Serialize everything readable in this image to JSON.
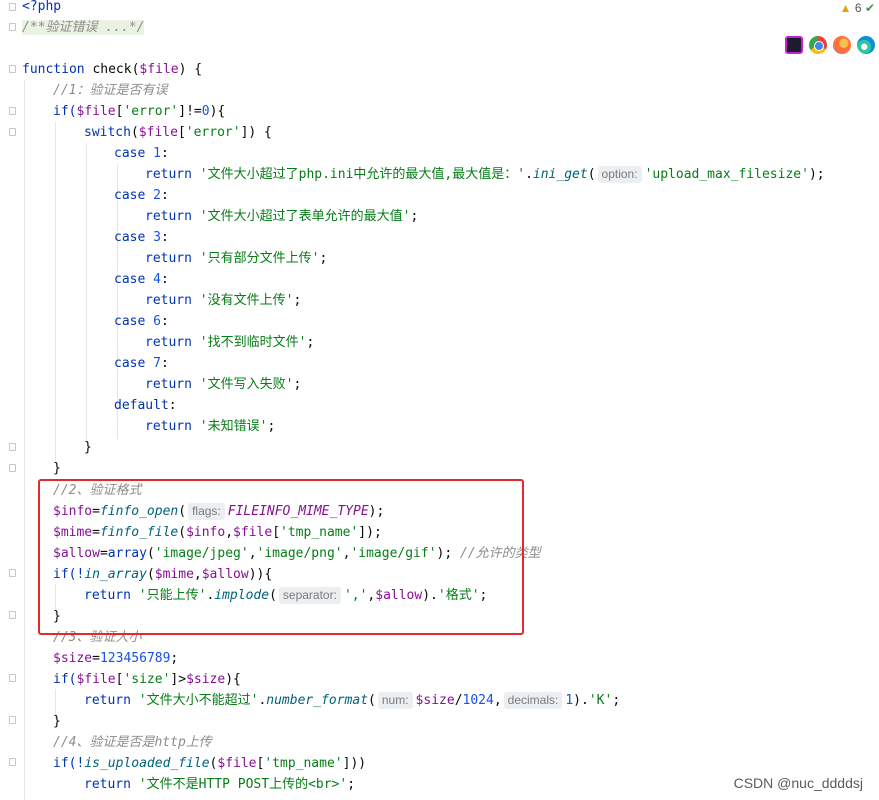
{
  "warnings": {
    "count": "6"
  },
  "browsers": [
    {
      "name": "phpstorm-icon",
      "color": "#1c1c2e"
    },
    {
      "name": "chrome-icon",
      "color": "#34a853"
    },
    {
      "name": "firefox-icon",
      "color": "#ff7139"
    },
    {
      "name": "edge-icon",
      "color": "#0c8fd6"
    }
  ],
  "code": {
    "l1": "<?php",
    "l2": "/**验证错误 ...*/",
    "l4a": "function",
    "l4b": " check(",
    "l4c": "$file",
    "l4d": ") {",
    "l5": "//1：验证是否有误",
    "l6a": "if(",
    "l6b": "$file",
    "l6c": "[",
    "l6d": "'error'",
    "l6e": "]!=",
    "l6f": "0",
    "l6g": "){",
    "l7a": "switch",
    "l7b": "(",
    "l7c": "$file",
    "l7d": "[",
    "l7e": "'error'",
    "l7f": "]) {",
    "c1a": "case ",
    "c1b": "1",
    "c1c": ":",
    "r1a": "return ",
    "r1b": "'文件大小超过了php.ini中允许的最大值,最大值是：'",
    "r1c": ".",
    "r1d": "ini_get",
    "r1e": "(",
    "r1hint": "option:",
    "r1f": "'upload_max_filesize'",
    "r1g": ");",
    "c2a": "case ",
    "c2b": "2",
    "c2c": ":",
    "r2a": "return ",
    "r2b": "'文件大小超过了表单允许的最大值'",
    "r2c": ";",
    "c3a": "case ",
    "c3b": "3",
    "c3c": ":",
    "r3a": "return ",
    "r3b": "'只有部分文件上传'",
    "r3c": ";",
    "c4a": "case ",
    "c4b": "4",
    "c4c": ":",
    "r4a": "return ",
    "r4b": "'没有文件上传'",
    "r4c": ";",
    "c6a": "case ",
    "c6b": "6",
    "c6c": ":",
    "r6a": "return ",
    "r6b": "'找不到临时文件'",
    "r6c": ";",
    "c7a": "case ",
    "c7b": "7",
    "c7c": ":",
    "r7a": "return ",
    "r7b": "'文件写入失败'",
    "r7c": ";",
    "da": "default",
    "db": ":",
    "rda": "return ",
    "rdb": "'未知错误'",
    "rdc": ";",
    "close1": "}",
    "close2": "}",
    "b2": "//2、验证格式",
    "b3a": "$info",
    "b3b": "=",
    "b3c": "finfo_open",
    "b3d": "(",
    "b3hint": "flags:",
    "b3e": "FILEINFO_MIME_TYPE",
    "b3f": ");",
    "b4a": "$mime",
    "b4b": "=",
    "b4c": "finfo_file",
    "b4d": "(",
    "b4e": "$info",
    "b4f": ",",
    "b4g": "$file",
    "b4h": "[",
    "b4i": "'tmp_name'",
    "b4j": "]);",
    "b5a": "$allow",
    "b5b": "=",
    "b5c": "array",
    "b5d": "(",
    "b5e": "'image/jpeg'",
    "b5f": ",",
    "b5g": "'image/png'",
    "b5h": ",",
    "b5i": "'image/gif'",
    "b5j": "); ",
    "b5k": "//允许的类型",
    "b6a": "if(!",
    "b6b": "in_array",
    "b6c": "(",
    "b6d": "$mime",
    "b6e": ",",
    "b6f": "$allow",
    "b6g": ")){",
    "b7a": "return ",
    "b7b": "'只能上传'",
    "b7c": ".",
    "b7d": "implode",
    "b7e": "(",
    "b7hint": "separator:",
    "b7f": "','",
    "b7g": ",",
    "b7h": "$allow",
    "b7i": ").",
    "b7j": "'格式'",
    "b7k": ";",
    "b8": "}",
    "s1": "//3、验证大小",
    "s2a": "$size",
    "s2b": "=",
    "s2c": "123456789",
    "s2d": ";",
    "s3a": "if(",
    "s3b": "$file",
    "s3c": "[",
    "s3d": "'size'",
    "s3e": "]>",
    "s3f": "$size",
    "s3g": "){",
    "s4a": "return ",
    "s4b": "'文件大小不能超过'",
    "s4c": ".",
    "s4d": "number_format",
    "s4e": "(",
    "s4hint": "num:",
    "s4f": "$size",
    "s4g": "/",
    "s4h": "1024",
    "s4i": ",",
    "s4hint2": "decimals:",
    "s4j": "1",
    "s4k": ").",
    "s4l": "'K'",
    "s4m": ";",
    "s5": "}",
    "h1": "//4、验证是否是http上传",
    "h2a": "if(!",
    "h2b": "is_uploaded_file",
    "h2c": "(",
    "h2d": "$file",
    "h2e": "[",
    "h2f": "'tmp_name'",
    "h2g": "]))",
    "h3a": "return ",
    "h3b": "'文件不是HTTP POST上传的<br>'",
    "h3c": ";"
  },
  "watermark": "CSDN @nuc_ddddsj"
}
